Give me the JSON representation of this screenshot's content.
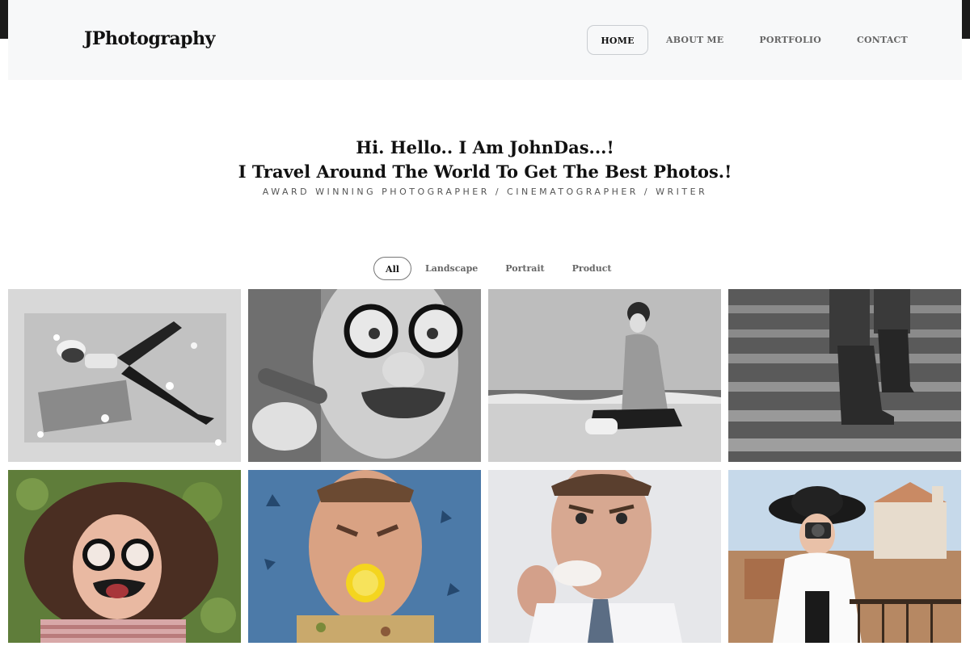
{
  "brand": {
    "logo": "JPhotography"
  },
  "nav": {
    "items": [
      {
        "label": "HOME",
        "active": true
      },
      {
        "label": "ABOUT ME",
        "active": false
      },
      {
        "label": "PORTFOLIO",
        "active": false
      },
      {
        "label": "CONTACT",
        "active": false
      }
    ]
  },
  "hero": {
    "line1": "Hi. Hello.. I Am JohnDas...!",
    "line2": "I Travel Around The World To Get The Best Photos.!",
    "subtitle": "AWARD WINNING PHOTOGRAPHER / CINEMATOGRAPHER / WRITER"
  },
  "filters": [
    {
      "label": "All",
      "active": true
    },
    {
      "label": "Landscape",
      "active": false
    },
    {
      "label": "Portrait",
      "active": false
    },
    {
      "label": "Product",
      "active": false
    }
  ],
  "gallery": [
    {
      "subject": "woman lying in leaves",
      "tone": "bw"
    },
    {
      "subject": "man with fake glasses and cigar",
      "tone": "bw"
    },
    {
      "subject": "woman sitting on beach",
      "tone": "bw"
    },
    {
      "subject": "boots on stairs",
      "tone": "bw"
    },
    {
      "subject": "woman with fake glasses on grass",
      "tone": "color"
    },
    {
      "subject": "man biting lemon",
      "tone": "color"
    },
    {
      "subject": "man eating cake",
      "tone": "color"
    },
    {
      "subject": "woman with camera in town",
      "tone": "color"
    }
  ],
  "colors": {
    "header_bg": "#f7f8f9",
    "text_dark": "#111111",
    "text_muted": "#666666"
  }
}
